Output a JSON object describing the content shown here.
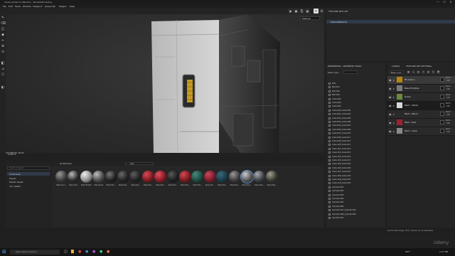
{
  "window": {
    "title": "metal_ladder.xs (Painter) - Wickedatinceding",
    "controls": [
      "—",
      "☐",
      "✕"
    ]
  },
  "menu": [
    "File",
    "Edit",
    "Mode",
    "Window",
    "Viewport",
    "Javascript",
    "Plugins",
    "Help"
  ],
  "viewport": {
    "dropdown_value": "Material",
    "geometry_label": "GEOMETRY MASK"
  },
  "right_top": {
    "tab": "TEXTURE SET LIST",
    "row": "DefaultMaterial"
  },
  "properties": {
    "tab": "PROPERTIES - GEOMETRY MASK",
    "mask_label": "Mask type",
    "items": [
      "Bolt",
      "Bolt.001",
      "Bolt.002",
      "Bolt.003",
      "Cube.003",
      "Cube.006",
      "Cube.009",
      "Cube.090_Cube.002",
      "Cube.091_Cube.003",
      "Cube.093_Cube.005",
      "Cube.094_Cube.006",
      "Cube.095_Cube.007",
      "Cube.096_Cube.009",
      "Cube.097_Cube.010",
      "Cube.098_Cube.011",
      "Cube.099_Cube.012",
      "Cube.100_Cube.013",
      "Cube.101_Cube.014",
      "Cube.102_Cube.015",
      "Cube.103_Cube.016",
      "Cube.104_Cube.017",
      "Cube.105_Cube.019",
      "Cube.106_Cube.020",
      "Cube.107_Cube.021",
      "Cube.108_Cube.022",
      "Cube.109_Cube.023",
      "Cube.110_Cube.024",
      "Cylinder.001",
      "Cylinder.002",
      "Cylinder.003",
      "Cylinder.004",
      "Cylinder.005",
      "Cylinder.006",
      "Cylinder.007_Cylinder.001",
      "Cylinder.008_Cylinder.002",
      "Cylinder.010"
    ]
  },
  "layers": {
    "tabs": [
      "LAYERS",
      "TEXTURE SET SETTINGS"
    ],
    "blend_dropdown": "Base color",
    "items": [
      {
        "name": "Fill Auto 1",
        "opacity": "100",
        "color": "#b8860b"
      },
      {
        "name": "Base Empties",
        "opacity": "100",
        "color": "#7a7a7a"
      },
      {
        "name": "Green",
        "opacity": "100",
        "color": "#6b8a3a"
      },
      {
        "name": "Paint - White",
        "opacity": "100",
        "color": "#d8d8d8"
      },
      {
        "name": "Paint - Black",
        "opacity": "100",
        "color": "#2a2a2a"
      },
      {
        "name": "Paint - Red",
        "opacity": "100",
        "color": "#a02030"
      },
      {
        "name": "Paint - Dark",
        "opacity": "100",
        "color": "#8a8a8a"
      }
    ]
  },
  "assets": {
    "tab": "ASSETS",
    "search_placeholder": "Search in asset",
    "library_title": "All libraries",
    "filter_value": "new",
    "sidebar_items": [
      "All libraries",
      "Project",
      "Starter assets",
      "Your assets"
    ],
    "materials": [
      {
        "label": "Steel Gun...",
        "color": "#3a3a3a",
        "hi": "#9a9a9a"
      },
      {
        "label": "Steel Gal...",
        "color": "#2a2a2a",
        "hi": "#bbbbbb"
      },
      {
        "label": "Steel Bright",
        "color": "#8c8c8c",
        "hi": "#f0f0f0"
      },
      {
        "label": "Steel Dark",
        "color": "#4a4a4a",
        "hi": "#bdbdbd"
      },
      {
        "label": "Steel Pai...",
        "color": "#1f1f1f",
        "hi": "#777777"
      },
      {
        "label": "Steel Pai...",
        "color": "#222222",
        "hi": "#6a6a6a"
      },
      {
        "label": "Steel Pai...",
        "color": "#202020",
        "hi": "#606060"
      },
      {
        "label": "Steel Pai...",
        "color": "#7a1a22",
        "hi": "#d84a55"
      },
      {
        "label": "Steel Pai...",
        "color": "#8a1a24",
        "hi": "#e05060"
      },
      {
        "label": "Steel Pai...",
        "color": "#1e1e1e",
        "hi": "#5a5a5a"
      },
      {
        "label": "Steel Pai...",
        "color": "#7a1a20",
        "hi": "#d04a50"
      },
      {
        "label": "Steel Pai...",
        "color": "#1c4a40",
        "hi": "#4a8a7a"
      },
      {
        "label": "Steel Pai...",
        "color": "#7a1a2a",
        "hi": "#c84a5a"
      },
      {
        "label": "Steel Pai...",
        "color": "#1a3a4a",
        "hi": "#3a6a7a"
      },
      {
        "label": "Steel Pai...",
        "color": "#3a3a3a",
        "hi": "#999999"
      },
      {
        "label": "Steel Rou...",
        "color": "#555555",
        "hi": "#cccccc"
      },
      {
        "label": "Steel Ste...",
        "color": "#3a3e40",
        "hi": "#a8acb0"
      },
      {
        "label": "Steel Wal...",
        "color": "#383830",
        "hi": "#a0a090"
      }
    ]
  },
  "status": {
    "right": "Cache Disk Usage: 24% | Version 8.1.2 (Sandbox)",
    "watermark": "Udemy"
  },
  "taskbar": {
    "search_placeholder": "Type here to search",
    "temp": "58°F",
    "time": "1:37 PM"
  }
}
